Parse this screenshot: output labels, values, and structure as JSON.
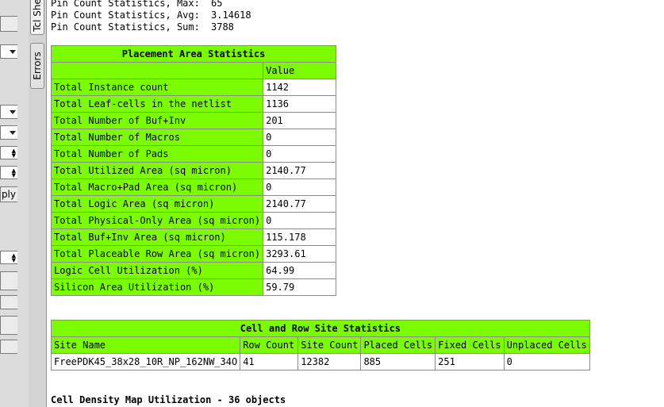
{
  "tabs": [
    "Tcl She",
    "Errors"
  ],
  "left_panel": {
    "apply_label": "ply"
  },
  "pin_stats": [
    {
      "label": "Pin Count Statistics, Max:",
      "value": "65"
    },
    {
      "label": "Pin Count Statistics, Avg:",
      "value": "3.14618"
    },
    {
      "label": "Pin Count Statistics, Sum:",
      "value": "3788"
    }
  ],
  "placement": {
    "title": "Placement Area Statistics",
    "value_header": "Value",
    "rows": [
      {
        "label": "Total Instance count",
        "value": "1142"
      },
      {
        "label": "Total Leaf-cells in the netlist",
        "value": "1136"
      },
      {
        "label": "Total Number of Buf+Inv",
        "value": "201"
      },
      {
        "label": "Total Number of Macros",
        "value": "0"
      },
      {
        "label": "Total Number of Pads",
        "value": "0"
      },
      {
        "label": "Total Utilized Area (sq micron)",
        "value": "2140.77"
      },
      {
        "label": "Total Macro+Pad Area (sq micron)",
        "value": "0"
      },
      {
        "label": "Total Logic Area (sq micron)",
        "value": "2140.77"
      },
      {
        "label": "Total Physical-Only Area (sq micron)",
        "value": "0"
      },
      {
        "label": "Total Buf+Inv Area (sq micron)",
        "value": "115.178"
      },
      {
        "label": "Total Placeable Row Area (sq micron)",
        "value": "3293.61"
      },
      {
        "label": "Logic Cell Utilization (%)",
        "value": "64.99"
      },
      {
        "label": "Silicon Area Utilization (%)",
        "value": "59.79"
      }
    ]
  },
  "site_stats": {
    "title": "Cell and Row Site Statistics",
    "headers": [
      "Site Name",
      "Row Count",
      "Site Count",
      "Placed Cells",
      "Fixed Cells",
      "Unplaced Cells"
    ],
    "row": [
      "FreePDK45_38x28_10R_NP_162NW_34O",
      "41",
      "12382",
      "885",
      "251",
      "0"
    ]
  },
  "density_title": "Cell Density Map Utilization - 36 objects",
  "colors": {
    "header_green": "#7cfc00",
    "cell_white": "#ffffff"
  }
}
